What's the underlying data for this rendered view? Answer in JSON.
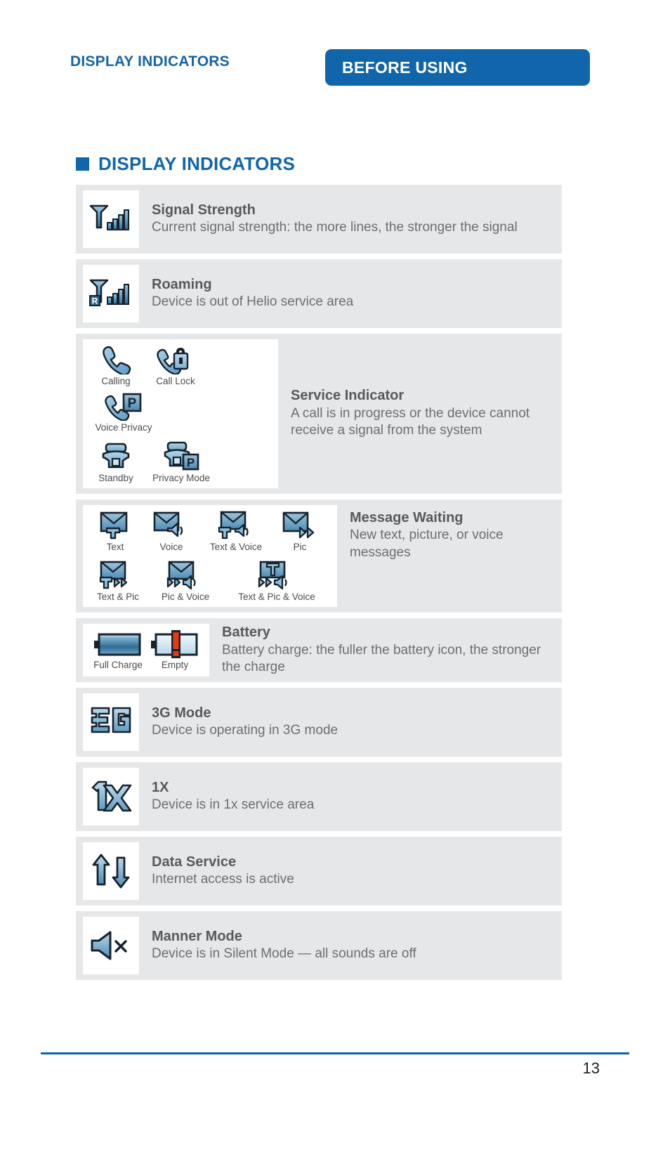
{
  "header": {
    "running_head": "DISPLAY INDICATORS",
    "section_tab_label": "BEFORE USING"
  },
  "section": {
    "title": "DISPLAY INDICATORS",
    "bullet_color": "#1065ab"
  },
  "colors": {
    "accent_blue": "#1065ab",
    "row_background": "#e6e7e8",
    "title_gray": "#58595b",
    "body_gray": "#6d6e71",
    "icon_blue": "#5b9bc4",
    "icon_blue_dark": "#2c6a96",
    "battery_warning_red": "#e8380d"
  },
  "rows": [
    {
      "title": "Signal Strength",
      "desc": "Current signal strength: the more lines, the stronger the signal",
      "icon_name": "signal-strength-icon",
      "icons": []
    },
    {
      "title": "Roaming",
      "desc": "Device is out of Helio service area",
      "icon_name": "roaming-icon",
      "icons": []
    },
    {
      "title": "Service Indicator",
      "desc": "A call is in progress or the device cannot receive a signal from the system",
      "icon_name": "service-indicator-icons",
      "icons": [
        {
          "label": "Calling",
          "icon_name": "calling-icon"
        },
        {
          "label": "Call Lock",
          "icon_name": "call-lock-icon"
        },
        {
          "label": "Voice Privacy",
          "icon_name": "voice-privacy-icon"
        },
        {
          "label": "Standby",
          "icon_name": "standby-icon"
        },
        {
          "label": "Privacy Mode",
          "icon_name": "privacy-mode-icon"
        }
      ]
    },
    {
      "title": "Message Waiting",
      "desc": "New text, picture, or voice messages",
      "icon_name": "message-waiting-icons",
      "icons": [
        {
          "label": "Text",
          "icon_name": "message-text-icon"
        },
        {
          "label": "Voice",
          "icon_name": "message-voice-icon"
        },
        {
          "label": "Text & Voice",
          "icon_name": "message-text-voice-icon"
        },
        {
          "label": "Pic",
          "icon_name": "message-pic-icon"
        },
        {
          "label": "Text & Pic",
          "icon_name": "message-text-pic-icon"
        },
        {
          "label": "Pic & Voice",
          "icon_name": "message-pic-voice-icon"
        },
        {
          "label": "Text & Pic & Voice",
          "icon_name": "message-text-pic-voice-icon"
        }
      ]
    },
    {
      "title": "Battery",
      "desc": "Battery charge: the fuller the battery icon, the stronger the charge",
      "icon_name": "battery-icons",
      "icons": [
        {
          "label": "Full Charge",
          "icon_name": "battery-full-icon"
        },
        {
          "label": "Empty",
          "icon_name": "battery-empty-icon"
        }
      ]
    },
    {
      "title": "3G Mode",
      "desc": "Device is operating in 3G mode",
      "icon_name": "three-g-mode-icon",
      "icons": []
    },
    {
      "title": "1X",
      "desc": "Device is in 1x service area",
      "icon_name": "one-x-icon",
      "icons": []
    },
    {
      "title": "Data Service",
      "desc": "Internet access is active",
      "icon_name": "data-service-icon",
      "icons": []
    },
    {
      "title": "Manner Mode",
      "desc": "Device is in Silent Mode — all sounds are off",
      "icon_name": "manner-mode-icon",
      "icons": []
    }
  ],
  "footer": {
    "page_number": "13"
  }
}
